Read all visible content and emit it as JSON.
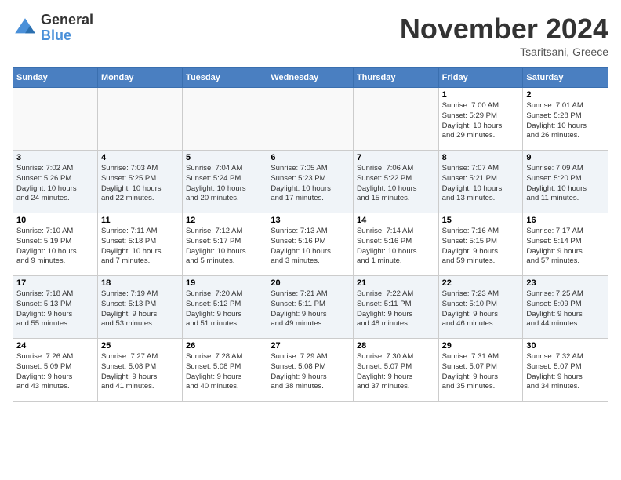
{
  "logo": {
    "general": "General",
    "blue": "Blue"
  },
  "header": {
    "month": "November 2024",
    "location": "Tsaritsani, Greece"
  },
  "weekdays": [
    "Sunday",
    "Monday",
    "Tuesday",
    "Wednesday",
    "Thursday",
    "Friday",
    "Saturday"
  ],
  "weeks": [
    [
      {
        "day": "",
        "info": ""
      },
      {
        "day": "",
        "info": ""
      },
      {
        "day": "",
        "info": ""
      },
      {
        "day": "",
        "info": ""
      },
      {
        "day": "",
        "info": ""
      },
      {
        "day": "1",
        "info": "Sunrise: 7:00 AM\nSunset: 5:29 PM\nDaylight: 10 hours\nand 29 minutes."
      },
      {
        "day": "2",
        "info": "Sunrise: 7:01 AM\nSunset: 5:28 PM\nDaylight: 10 hours\nand 26 minutes."
      }
    ],
    [
      {
        "day": "3",
        "info": "Sunrise: 7:02 AM\nSunset: 5:26 PM\nDaylight: 10 hours\nand 24 minutes."
      },
      {
        "day": "4",
        "info": "Sunrise: 7:03 AM\nSunset: 5:25 PM\nDaylight: 10 hours\nand 22 minutes."
      },
      {
        "day": "5",
        "info": "Sunrise: 7:04 AM\nSunset: 5:24 PM\nDaylight: 10 hours\nand 20 minutes."
      },
      {
        "day": "6",
        "info": "Sunrise: 7:05 AM\nSunset: 5:23 PM\nDaylight: 10 hours\nand 17 minutes."
      },
      {
        "day": "7",
        "info": "Sunrise: 7:06 AM\nSunset: 5:22 PM\nDaylight: 10 hours\nand 15 minutes."
      },
      {
        "day": "8",
        "info": "Sunrise: 7:07 AM\nSunset: 5:21 PM\nDaylight: 10 hours\nand 13 minutes."
      },
      {
        "day": "9",
        "info": "Sunrise: 7:09 AM\nSunset: 5:20 PM\nDaylight: 10 hours\nand 11 minutes."
      }
    ],
    [
      {
        "day": "10",
        "info": "Sunrise: 7:10 AM\nSunset: 5:19 PM\nDaylight: 10 hours\nand 9 minutes."
      },
      {
        "day": "11",
        "info": "Sunrise: 7:11 AM\nSunset: 5:18 PM\nDaylight: 10 hours\nand 7 minutes."
      },
      {
        "day": "12",
        "info": "Sunrise: 7:12 AM\nSunset: 5:17 PM\nDaylight: 10 hours\nand 5 minutes."
      },
      {
        "day": "13",
        "info": "Sunrise: 7:13 AM\nSunset: 5:16 PM\nDaylight: 10 hours\nand 3 minutes."
      },
      {
        "day": "14",
        "info": "Sunrise: 7:14 AM\nSunset: 5:16 PM\nDaylight: 10 hours\nand 1 minute."
      },
      {
        "day": "15",
        "info": "Sunrise: 7:16 AM\nSunset: 5:15 PM\nDaylight: 9 hours\nand 59 minutes."
      },
      {
        "day": "16",
        "info": "Sunrise: 7:17 AM\nSunset: 5:14 PM\nDaylight: 9 hours\nand 57 minutes."
      }
    ],
    [
      {
        "day": "17",
        "info": "Sunrise: 7:18 AM\nSunset: 5:13 PM\nDaylight: 9 hours\nand 55 minutes."
      },
      {
        "day": "18",
        "info": "Sunrise: 7:19 AM\nSunset: 5:13 PM\nDaylight: 9 hours\nand 53 minutes."
      },
      {
        "day": "19",
        "info": "Sunrise: 7:20 AM\nSunset: 5:12 PM\nDaylight: 9 hours\nand 51 minutes."
      },
      {
        "day": "20",
        "info": "Sunrise: 7:21 AM\nSunset: 5:11 PM\nDaylight: 9 hours\nand 49 minutes."
      },
      {
        "day": "21",
        "info": "Sunrise: 7:22 AM\nSunset: 5:11 PM\nDaylight: 9 hours\nand 48 minutes."
      },
      {
        "day": "22",
        "info": "Sunrise: 7:23 AM\nSunset: 5:10 PM\nDaylight: 9 hours\nand 46 minutes."
      },
      {
        "day": "23",
        "info": "Sunrise: 7:25 AM\nSunset: 5:09 PM\nDaylight: 9 hours\nand 44 minutes."
      }
    ],
    [
      {
        "day": "24",
        "info": "Sunrise: 7:26 AM\nSunset: 5:09 PM\nDaylight: 9 hours\nand 43 minutes."
      },
      {
        "day": "25",
        "info": "Sunrise: 7:27 AM\nSunset: 5:08 PM\nDaylight: 9 hours\nand 41 minutes."
      },
      {
        "day": "26",
        "info": "Sunrise: 7:28 AM\nSunset: 5:08 PM\nDaylight: 9 hours\nand 40 minutes."
      },
      {
        "day": "27",
        "info": "Sunrise: 7:29 AM\nSunset: 5:08 PM\nDaylight: 9 hours\nand 38 minutes."
      },
      {
        "day": "28",
        "info": "Sunrise: 7:30 AM\nSunset: 5:07 PM\nDaylight: 9 hours\nand 37 minutes."
      },
      {
        "day": "29",
        "info": "Sunrise: 7:31 AM\nSunset: 5:07 PM\nDaylight: 9 hours\nand 35 minutes."
      },
      {
        "day": "30",
        "info": "Sunrise: 7:32 AM\nSunset: 5:07 PM\nDaylight: 9 hours\nand 34 minutes."
      }
    ]
  ]
}
